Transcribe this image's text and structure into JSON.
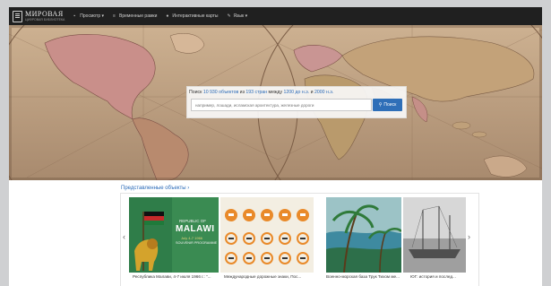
{
  "header": {
    "logo_title": "МИРОВАЯ",
    "logo_subtitle": "ЦИФРОВАЯ БИБЛИОТЕКА",
    "nav": [
      {
        "label": "Просмотр ▾",
        "icon": "browse-icon"
      },
      {
        "label": "Временные рамки",
        "icon": "timeline-icon"
      },
      {
        "label": "Интерактивные карты",
        "icon": "globe-icon"
      },
      {
        "label": "Язык ▾",
        "icon": "language-icon"
      }
    ]
  },
  "search": {
    "prefix": "Поиск ",
    "count": "10 930 объектов",
    "from": " из ",
    "countries": "193 стран",
    "between": " между ",
    "start": "1200 до н.э.",
    "and": " и ",
    "end": "2000 н.э.",
    "placeholder": "например, лошади, исламская архитектура, железные дороги",
    "button": "Поиск"
  },
  "featured": {
    "title": "Представленные объекты ›",
    "items": [
      {
        "caption": "Республика Малави, 4-7 июля 1966 г.: \"..."
      },
      {
        "caption": "Международные дорожные знаки, Пос..."
      },
      {
        "caption": "Военно-морская база Трук Тихом ме..."
      },
      {
        "caption": "ЮГ: история и послед..."
      }
    ],
    "poster_malawi": {
      "line1": "REPUBLIC OF",
      "line2": "MALAWI",
      "line3": "July 4-7 1966",
      "line4": "SOUVENIR PROGRAMME"
    }
  },
  "colors": {
    "accent": "#2f6fb8",
    "topbar": "#202020"
  }
}
